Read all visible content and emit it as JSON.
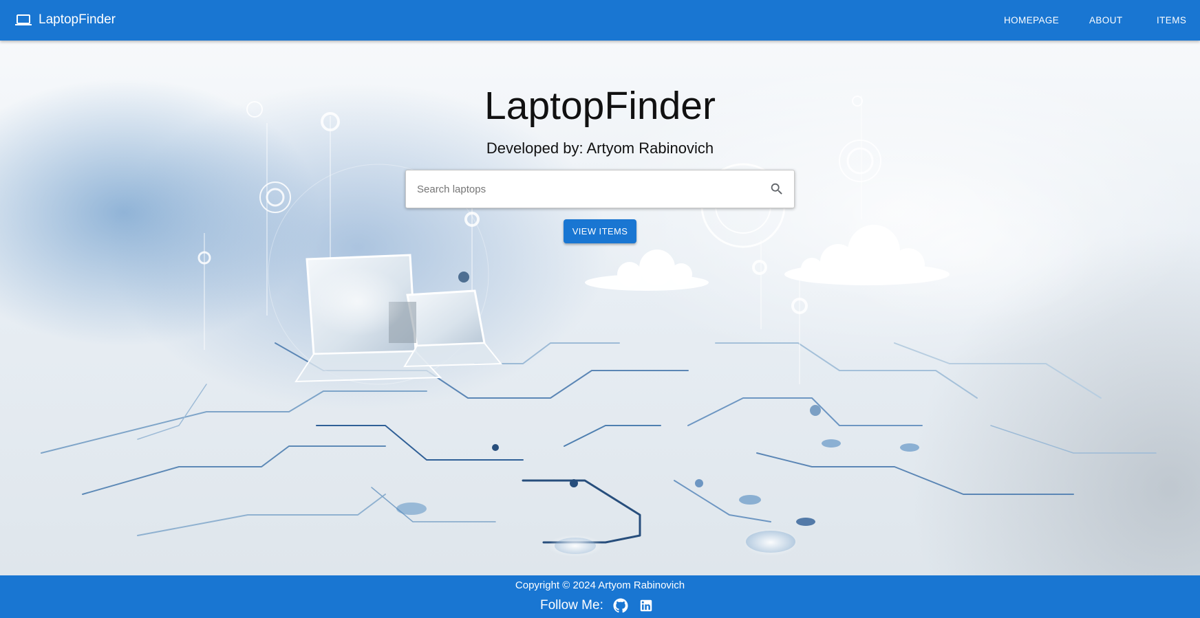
{
  "header": {
    "brand": "LaptopFinder",
    "brand_icon": "laptop-icon",
    "nav": [
      "HOMEPAGE",
      "ABOUT",
      "ITEMS"
    ]
  },
  "hero": {
    "title": "LaptopFinder",
    "subtitle": "Developed by: Artyom Rabinovich",
    "search": {
      "placeholder": "Search laptops",
      "value": "",
      "icon": "search-icon"
    },
    "button": "VIEW ITEMS"
  },
  "footer": {
    "copyright": "Copyright © 2024 Artyom Rabinovich",
    "follow_label": "Follow Me:",
    "social": [
      "github-icon",
      "linkedin-icon"
    ]
  },
  "colors": {
    "primary": "#1976d2",
    "text": "#111111",
    "white": "#ffffff"
  }
}
